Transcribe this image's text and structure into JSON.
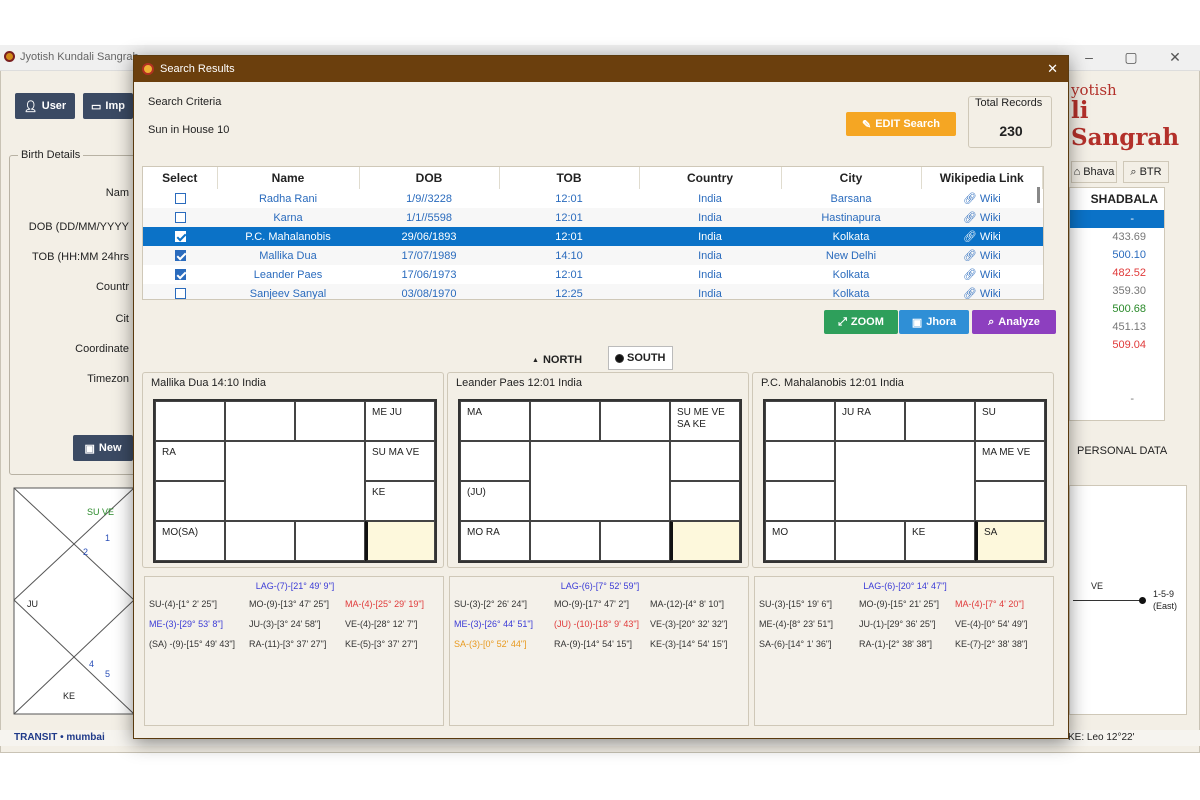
{
  "app": {
    "title": "Jyotish Kundali Sangrah",
    "brand_line1": "yotish",
    "brand_line2": "li Sangrah",
    "user_button": "User",
    "import_button": "Imp",
    "birth_details_title": "Birth Details",
    "fields": [
      "Nam",
      "DOB (DD/MM/YYYY",
      "TOB (HH:MM 24hrs",
      "Countr",
      "Cit",
      "Coordinate",
      "Timezon"
    ],
    "new_button": "New",
    "right_tabs": [
      "Bhava",
      "BTR"
    ],
    "shadbala_header": "SHADBALA",
    "shadbala_values": [
      "-",
      "433.69",
      "500.10",
      "482.52",
      "359.30",
      "500.68",
      "451.13",
      "509.04",
      "-"
    ],
    "personal_data": "PERSONAL DATA",
    "chart_labels": {
      "su_ve": "SU VE",
      "ju": "JU",
      "ke": "KE",
      "n1": "1",
      "n2": "2",
      "n4": "4",
      "n5": "5"
    },
    "transit_chart": {
      "ve": "VE",
      "house": "1-5-9",
      "dir": "(East)"
    },
    "status_left": "TRANSIT • mumbai",
    "status_right": "KE: Leo 12°22'"
  },
  "dialog": {
    "title": "Search Results",
    "close": "✕",
    "criteria_label": "Search Criteria",
    "criteria_value": "Sun in House 10",
    "edit_button": "EDIT Search",
    "total_label": "Total Records",
    "total_value": "230",
    "columns": [
      "Select",
      "Name",
      "DOB",
      "TOB",
      "Country",
      "City",
      "Wikipedia Link"
    ],
    "rows": [
      {
        "checked": false,
        "name": "Radha Rani",
        "dob": "1/9//3228",
        "tob": "12:01",
        "country": "India",
        "city": "Barsana",
        "wiki": "Wiki",
        "selected": false
      },
      {
        "checked": false,
        "name": "Karna",
        "dob": "1/1//5598",
        "tob": "12:01",
        "country": "India",
        "city": "Hastinapura",
        "wiki": "Wiki",
        "selected": false
      },
      {
        "checked": true,
        "name": "P.C. Mahalanobis",
        "dob": "29/06/1893",
        "tob": "12:01",
        "country": "India",
        "city": "Kolkata",
        "wiki": "Wiki",
        "selected": true
      },
      {
        "checked": true,
        "name": "Mallika Dua",
        "dob": "17/07/1989",
        "tob": "14:10",
        "country": "India",
        "city": "New Delhi",
        "wiki": "Wiki",
        "selected": false
      },
      {
        "checked": true,
        "name": "Leander Paes",
        "dob": "17/06/1973",
        "tob": "12:01",
        "country": "India",
        "city": "Kolkata",
        "wiki": "Wiki",
        "selected": false
      },
      {
        "checked": false,
        "name": "Sanjeev Sanyal",
        "dob": "03/08/1970",
        "tob": "12:25",
        "country": "India",
        "city": "Kolkata",
        "wiki": "Wiki",
        "selected": false
      }
    ],
    "zoom_button": "ZOOM",
    "jhora_button": "Jhora",
    "analyze_button": "Analyze",
    "north_label": "NORTH",
    "south_label": "SOUTH",
    "charts": [
      {
        "title": "Mallika Dua 14:10 India",
        "cells": {
          "r0c3": "ME JU",
          "r1c0": "RA",
          "r1c3": "SU MA VE",
          "r2c3": "KE",
          "r3c0": "MO(SA)"
        },
        "lag": "LAG-(7)-[21° 49' 9\"]",
        "positions": [
          "SU-(4)-[1° 2' 25\"]",
          "MO-(9)-[13° 47' 25\"]",
          "MA-(4)-[25° 29' 19\"]",
          "ME-(3)-[29° 53' 8\"]",
          "JU-(3)-[3° 24' 58\"]",
          "VE-(4)-[28° 12' 7\"]",
          "(SA) -(9)-[15° 49' 43\"]",
          "RA-(11)-[3° 37' 27\"]",
          "KE-(5)-[3° 37' 27\"]"
        ]
      },
      {
        "title": "Leander Paes 12:01 India",
        "cells": {
          "r0c0": "MA",
          "r0c3": "SU ME VE SA KE",
          "r2c0": "(JU)",
          "r3c0": "MO RA"
        },
        "lag": "LAG-(6)-[7° 52' 59\"]",
        "positions": [
          "SU-(3)-[2° 26' 24\"]",
          "MO-(9)-[17° 47' 2\"]",
          "MA-(12)-[4° 8' 10\"]",
          "ME-(3)-[26° 44' 51\"]",
          "(JU) -(10)-[18° 9' 43\"]",
          "VE-(3)-[20° 32' 32\"]",
          "SA-(3)-[0° 52' 44\"]",
          "RA-(9)-[14° 54' 15\"]",
          "KE-(3)-[14° 54' 15\"]"
        ]
      },
      {
        "title": "P.C. Mahalanobis 12:01 India",
        "cells": {
          "r0c1": "JU RA",
          "r0c3": "SU",
          "r1c3": "MA ME VE",
          "r3c0": "MO",
          "r3c2": "KE",
          "r3c3": "SA"
        },
        "lag": "LAG-(6)-[20° 14' 47\"]",
        "positions": [
          "SU-(3)-[15° 19' 6\"]",
          "MO-(9)-[15° 21' 25\"]",
          "MA-(4)-[7° 4' 20\"]",
          "ME-(4)-[8° 23' 51\"]",
          "JU-(1)-[29° 36' 25\"]",
          "VE-(4)-[0° 54' 49\"]",
          "SA-(6)-[14° 1' 36\"]",
          "RA-(1)-[2° 38' 38\"]",
          "KE-(7)-[2° 38' 38\"]"
        ]
      }
    ]
  },
  "colors": {
    "brand": "#b3302a",
    "dialog_title": "#6b3f0d",
    "selected_row": "#0b72c7",
    "edit": "#f5a623",
    "zoom": "#2e9f5b",
    "jhora": "#2f8fd6",
    "analyze": "#8d3fbf"
  }
}
